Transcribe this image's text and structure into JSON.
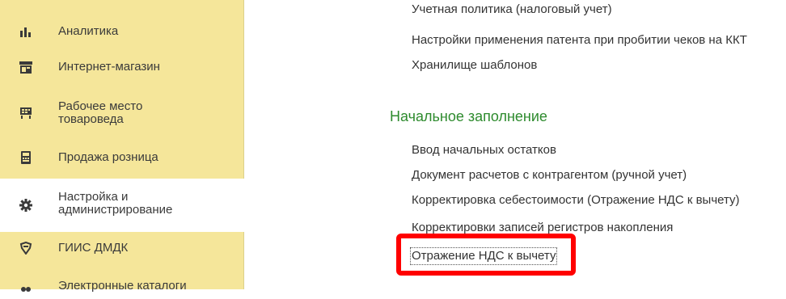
{
  "sidebar": {
    "items": [
      {
        "label": "Аналитика",
        "icon": "bar-chart-icon"
      },
      {
        "label": "Интернет-магазин",
        "icon": "storefront-icon"
      },
      {
        "label": "Рабочее место\nтовароведа",
        "icon": "cart-icon"
      },
      {
        "label": "Продажа розница",
        "icon": "register-icon"
      },
      {
        "label": "Настройка и\nадминистрирование",
        "icon": "gear-icon",
        "active": true
      },
      {
        "label": "ГИИС ДМДК",
        "icon": "gem-icon"
      },
      {
        "label": "Электронные каталоги",
        "icon": "catalog-icon"
      }
    ]
  },
  "main": {
    "top_links": [
      "Учетная политика (налоговый учет)",
      "Настройки применения патента при пробитии чеков на ККТ",
      "Хранилище шаблонов"
    ],
    "section": {
      "title": "Начальное заполнение",
      "links": [
        "Ввод начальных остатков",
        "Документ расчетов с контрагентом (ручной учет)",
        "Корректировка себестоимости (Отражение НДС к вычету)",
        "Корректировки записей регистров накопления",
        "Отражение НДС к вычету"
      ]
    }
  },
  "colors": {
    "sidebar_bg": "#f5e69a",
    "section_title": "#2e8b2e",
    "highlight": "#ff0000"
  }
}
